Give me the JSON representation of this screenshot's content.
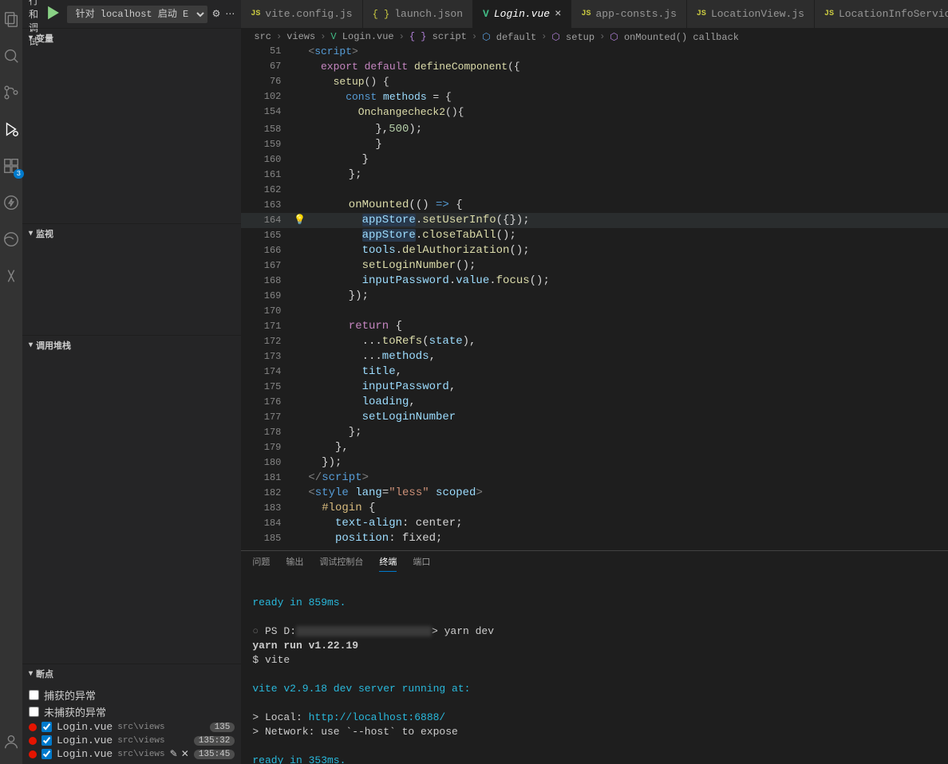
{
  "activity": {
    "badge": "3"
  },
  "debugHeader": {
    "title": "运行和调试",
    "config": "针对 localhost 启动 E"
  },
  "sections": {
    "vars": "变量",
    "watch": "监视",
    "callstack": "调用堆栈",
    "breakpoints": "断点"
  },
  "breakpointChecks": {
    "caught": "捕获的异常",
    "uncaught": "未捕获的异常"
  },
  "breakpoints": [
    {
      "file": "Login.vue",
      "path": "src\\views",
      "badge": "135"
    },
    {
      "file": "Login.vue",
      "path": "src\\views",
      "badge": "135:32"
    },
    {
      "file": "Login.vue",
      "path": "src\\views",
      "badge": "135:45"
    }
  ],
  "tabs": [
    {
      "icon": "js",
      "label": "vite.config.js"
    },
    {
      "icon": "json",
      "label": "launch.json"
    },
    {
      "icon": "vue",
      "label": "Login.vue",
      "active": true,
      "close": true
    },
    {
      "icon": "js",
      "label": "app-consts.js"
    },
    {
      "icon": "js",
      "label": "LocationView.js"
    },
    {
      "icon": "js",
      "label": "LocationInfoService.js"
    }
  ],
  "breadcrumb": [
    "src",
    "views",
    "Login.vue",
    "script",
    "default",
    "setup",
    "onMounted() callback"
  ],
  "sticky": [
    {
      "n": "51",
      "html": "<span class='tag'>&lt;</span><span class='tagname'>script</span><span class='tag'>&gt;</span>"
    },
    {
      "n": "67",
      "html": "  <span class='kw2'>export</span> <span class='kw2'>default</span> <span class='fn'>defineComponent</span>({"
    },
    {
      "n": "76",
      "html": "    <span class='fn'>setup</span>() {"
    },
    {
      "n": "102",
      "html": "      <span class='kw'>const</span> <span class='var'>methods</span> = {"
    },
    {
      "n": "154",
      "html": "        <span class='fn'>Onchangecheck2</span>(){"
    }
  ],
  "lines": [
    {
      "n": "158",
      "html": "          },<span class='num'>500</span>);"
    },
    {
      "n": "159",
      "html": "          }"
    },
    {
      "n": "160",
      "html": "        }"
    },
    {
      "n": "161",
      "html": "      };"
    },
    {
      "n": "162",
      "html": ""
    },
    {
      "n": "163",
      "html": "      <span class='fn'>onMounted</span>(() <span class='kw'>=&gt;</span> {"
    },
    {
      "n": "164",
      "current": true,
      "bulb": true,
      "html": "        <span class='hl'>appStore</span>.<span class='fn'>setUserInfo</span>({});"
    },
    {
      "n": "165",
      "html": "        <span class='hl'>appStore</span>.<span class='fn'>closeTabAll</span>();"
    },
    {
      "n": "166",
      "html": "        <span class='var'>tools</span>.<span class='fn'>delAuthorization</span>();"
    },
    {
      "n": "167",
      "html": "        <span class='fn'>setLoginNumber</span>();"
    },
    {
      "n": "168",
      "html": "        <span class='var'>inputPassword</span>.<span class='prop'>value</span>.<span class='fn'>focus</span>();"
    },
    {
      "n": "169",
      "html": "      });"
    },
    {
      "n": "170",
      "html": ""
    },
    {
      "n": "171",
      "html": "      <span class='kw2'>return</span> {"
    },
    {
      "n": "172",
      "html": "        ...<span class='fn'>toRefs</span>(<span class='var'>state</span>),"
    },
    {
      "n": "173",
      "html": "        ...<span class='var'>methods</span>,"
    },
    {
      "n": "174",
      "html": "        <span class='var'>title</span>,"
    },
    {
      "n": "175",
      "html": "        <span class='var'>inputPassword</span>,"
    },
    {
      "n": "176",
      "html": "        <span class='var'>loading</span>,"
    },
    {
      "n": "177",
      "html": "        <span class='var'>setLoginNumber</span>"
    },
    {
      "n": "178",
      "html": "      };"
    },
    {
      "n": "179",
      "html": "    },"
    },
    {
      "n": "180",
      "html": "  });"
    },
    {
      "n": "181",
      "html": "<span class='tag'>&lt;/</span><span class='tagname'>script</span><span class='tag'>&gt;</span>"
    },
    {
      "n": "182",
      "html": "<span class='tag'>&lt;</span><span class='tagname'>style</span> <span class='attr'>lang</span>=<span class='str'>\"less\"</span> <span class='attr'>scoped</span><span class='tag'>&gt;</span>"
    },
    {
      "n": "183",
      "html": "  <span class='sel'>#login</span> {"
    },
    {
      "n": "184",
      "html": "    <span class='cssprop'>text-align</span>: center;"
    },
    {
      "n": "185",
      "html": "    <span class='cssprop'>position</span>: fixed;"
    }
  ],
  "panelTabs": [
    "问题",
    "输出",
    "调试控制台",
    "终端",
    "端口"
  ],
  "activePanelTab": 3,
  "terminal": {
    "ready1": "ready in 859ms.",
    "prompt": "PS D:",
    "cmd": "yarn dev",
    "run": "yarn run v1.22.19",
    "vite": "$ vite",
    "server": "vite v2.9.18 dev server running at:",
    "local": "> Local:",
    "localUrl": "http://localhost:6888/",
    "network": "> Network: use `--host` to expose",
    "ready2": "ready in 353ms."
  }
}
